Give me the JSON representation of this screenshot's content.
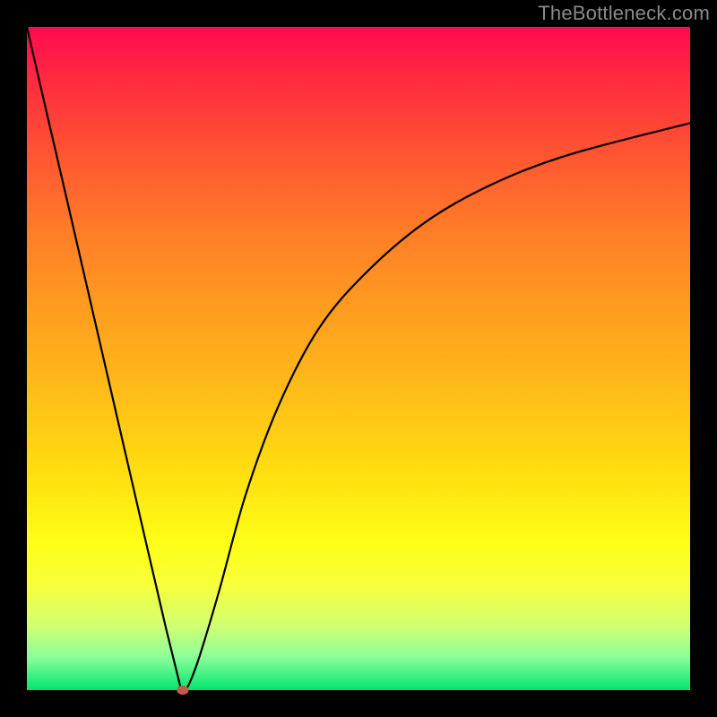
{
  "watermark": "TheBottleneck.com",
  "chart_data": {
    "type": "line",
    "title": "",
    "xlabel": "",
    "ylabel": "",
    "xlim": [
      0,
      1
    ],
    "ylim": [
      0,
      1
    ],
    "grid": false,
    "legend": false,
    "series": [
      {
        "name": "curve",
        "color": "#000000",
        "x": [
          0.0,
          0.03,
          0.06,
          0.09,
          0.12,
          0.15,
          0.18,
          0.21,
          0.232,
          0.235,
          0.24,
          0.245,
          0.26,
          0.29,
          0.33,
          0.38,
          0.44,
          0.51,
          0.6,
          0.7,
          0.82,
          1.0
        ],
        "y": [
          1.0,
          0.87,
          0.741,
          0.611,
          0.481,
          0.351,
          0.221,
          0.092,
          0.003,
          0.0,
          0.003,
          0.01,
          0.05,
          0.15,
          0.295,
          0.43,
          0.545,
          0.628,
          0.705,
          0.762,
          0.808,
          0.855
        ]
      }
    ],
    "marker": {
      "name": "minimum-dot",
      "color": "#c45a4e",
      "x": 0.235,
      "y": 0.0,
      "rx": 0.009,
      "ry": 0.007
    },
    "background_gradient": {
      "direction": "vertical",
      "stops": [
        {
          "pos": 0.0,
          "color": "#ff0a50"
        },
        {
          "pos": 0.08,
          "color": "#ff2b3f"
        },
        {
          "pos": 0.2,
          "color": "#ff5830"
        },
        {
          "pos": 0.3,
          "color": "#ff7a28"
        },
        {
          "pos": 0.42,
          "color": "#ff9b20"
        },
        {
          "pos": 0.55,
          "color": "#ffbc18"
        },
        {
          "pos": 0.68,
          "color": "#ffe010"
        },
        {
          "pos": 0.78,
          "color": "#ffff17"
        },
        {
          "pos": 0.84,
          "color": "#f8ff3a"
        },
        {
          "pos": 0.9,
          "color": "#d4ff70"
        },
        {
          "pos": 0.95,
          "color": "#8dff9a"
        },
        {
          "pos": 1.0,
          "color": "#00e56f"
        }
      ]
    }
  }
}
